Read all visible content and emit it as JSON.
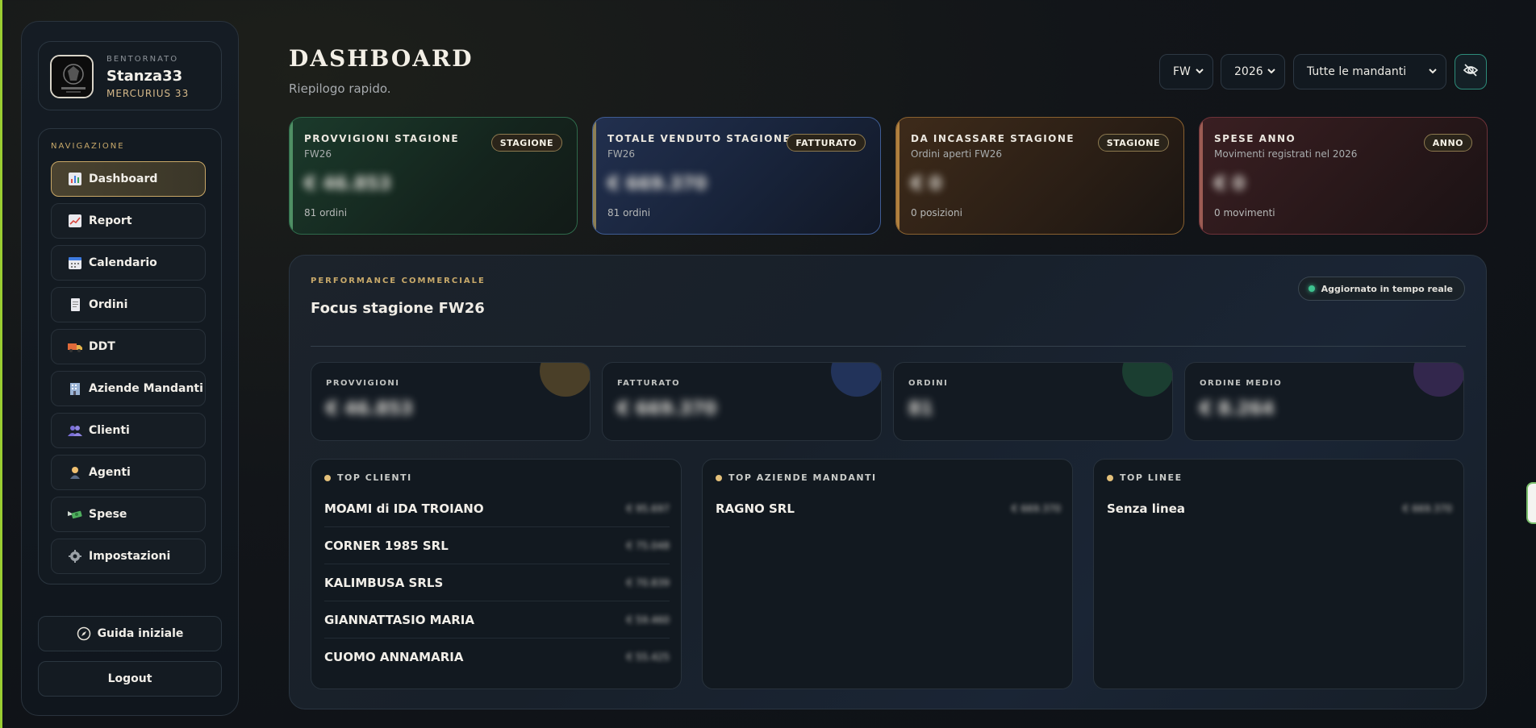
{
  "user": {
    "kicker": "BENTORNATO",
    "name": "Stanza33",
    "company": "MERCURIUS 33"
  },
  "nav": {
    "title": "NAVIGAZIONE",
    "items": [
      {
        "label": "Dashboard",
        "icon": "bar-chart-icon",
        "active": true
      },
      {
        "label": "Report",
        "icon": "trend-chart-icon",
        "active": false
      },
      {
        "label": "Calendario",
        "icon": "calendar-icon",
        "active": false
      },
      {
        "label": "Ordini",
        "icon": "document-icon",
        "active": false
      },
      {
        "label": "DDT",
        "icon": "truck-icon",
        "active": false
      },
      {
        "label": "Aziende Mandanti",
        "icon": "building-icon",
        "active": false
      },
      {
        "label": "Clienti",
        "icon": "users-icon",
        "active": false
      },
      {
        "label": "Agenti",
        "icon": "agent-icon",
        "active": false
      },
      {
        "label": "Spese",
        "icon": "money-wings-icon",
        "active": false
      },
      {
        "label": "Impostazioni",
        "icon": "gear-icon",
        "active": false
      }
    ]
  },
  "bottom": {
    "guide_label": "Guida iniziale",
    "logout_label": "Logout"
  },
  "header": {
    "title": "DASHBOARD",
    "subtitle": "Riepilogo rapido."
  },
  "filters": {
    "season": "FW",
    "year": "2026",
    "mandanti": "Tutte le mandanti"
  },
  "kpis": [
    {
      "title": "PROVVIGIONI STAGIONE",
      "sub": "FW26",
      "badge": "STAGIONE",
      "value": "€ 46.853",
      "foot": "81 ordini",
      "color": "green"
    },
    {
      "title": "TOTALE VENDUTO STAGIONE",
      "sub": "FW26",
      "badge": "FATTURATO",
      "value": "€ 669.370",
      "foot": "81 ordini",
      "color": "blue"
    },
    {
      "title": "DA INCASSARE STAGIONE",
      "sub": "Ordini aperti FW26",
      "badge": "STAGIONE",
      "value": "€ 0",
      "foot": "0 posizioni",
      "color": "orange"
    },
    {
      "title": "SPESE ANNO",
      "sub": "Movimenti registrati nel 2026",
      "badge": "ANNO",
      "value": "€ 0",
      "foot": "0 movimenti",
      "color": "red"
    }
  ],
  "performance": {
    "kicker": "PERFORMANCE COMMERCIALE",
    "title": "Focus stagione FW26",
    "live_label": "Aggiornato in tempo reale",
    "metrics": [
      {
        "label": "PROVVIGIONI",
        "value": "€ 46.853",
        "blob": "#6b5a36"
      },
      {
        "label": "FATTURATO",
        "value": "€ 669.370",
        "blob": "#2b3f6b"
      },
      {
        "label": "ORDINI",
        "value": "81",
        "blob": "#1f4a3a"
      },
      {
        "label": "ORDINE MEDIO",
        "value": "€ 8.264",
        "blob": "#3e2f5c"
      }
    ],
    "top_clienti": {
      "title": "TOP CLIENTI",
      "rows": [
        {
          "name": "MOAMI di IDA TROIANO",
          "value": "€ 95.697"
        },
        {
          "name": "CORNER 1985 SRL",
          "value": "€ 75.048"
        },
        {
          "name": "KALIMBUSA SRLS",
          "value": "€ 70.839"
        },
        {
          "name": "GIANNATTASIO MARIA",
          "value": "€ 59.460"
        },
        {
          "name": "CUOMO ANNAMARIA",
          "value": "€ 55.425"
        }
      ]
    },
    "top_mandanti": {
      "title": "TOP AZIENDE MANDANTI",
      "rows": [
        {
          "name": "RAGNO SRL",
          "value": "€ 669.370"
        }
      ]
    },
    "top_linee": {
      "title": "TOP LINEE",
      "rows": [
        {
          "name": "Senza linea",
          "value": "€ 669.370"
        }
      ]
    }
  },
  "colors": {
    "gold": "#c9a867",
    "teal": "#2d8c7a",
    "live": "#3ec28f"
  }
}
